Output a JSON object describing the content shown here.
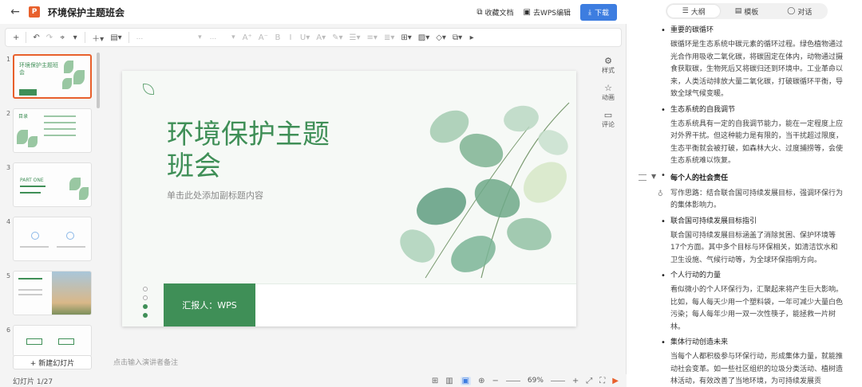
{
  "titlebar": {
    "back_icon": "back-arrow-icon",
    "app_icon_letter": "P",
    "doc_title": "环境保护主题班会",
    "collect": "收藏文档",
    "wps_edit": "去WPS编辑",
    "download": "下载"
  },
  "toolbar": {
    "font_placeholder": "...",
    "size_placeholder": "..."
  },
  "thumbnails": {
    "numbers": [
      "1",
      "2",
      "3",
      "4",
      "5",
      "6"
    ],
    "t1_title": "环境保护主题班会",
    "t2_title": "目录",
    "t3_title": "PART ONE",
    "new_slide": "+ 新建幻灯片"
  },
  "slide": {
    "title_line1": "环境保护主题",
    "title_line2": "班会",
    "subtitle": "单击此处添加副标题内容",
    "reporter": "汇报人：WPS"
  },
  "side_tools": {
    "style": "样式",
    "animation": "动画",
    "comment": "评论"
  },
  "notes_placeholder": "点击输入演讲者备注",
  "status": {
    "page": "幻灯片 1/27",
    "zoom": "69%"
  },
  "right_panel": {
    "tabs": [
      "大纲",
      "模板",
      "对话"
    ],
    "b1": "重要的碳循环",
    "p1": "碳循环是生态系统中碳元素的循环过程。绿色植物通过光合作用吸收二氧化碳，将碳固定在体内，动物通过摄食获取碳，生物死后又将碳归还到环境中。工业革命以来，人类活动排放大量二氧化碳，打破碳循环平衡，导致全球气候变暖。",
    "b2": "生态系统的自我调节",
    "p2": "生态系统具有一定的自我调节能力，能在一定程度上应对外界干扰。但这种能力是有限的，当干扰超过限度，生态平衡就会被打破，如森林大火、过度捕捞等，会使生态系统难以恢复。",
    "section": "每个人的社会责任",
    "hint": "写作思路：结合联合国可持续发展目标，强调环保行为的集体影响力。",
    "b3": "联合国可持续发展目标指引",
    "p3": "联合国可持续发展目标涵盖了消除贫困、保护环境等17个方面。其中多个目标与环保相关，如清洁饮水和卫生设施、气候行动等，为全球环保指明方向。",
    "b4": "个人行动的力量",
    "p4": "看似微小的个人环保行为，汇聚起来将产生巨大影响。比如，每人每天少用一个塑料袋，一年可减少大量白色污染；每人每年少用一双一次性筷子，能拯救一片树林。",
    "b5": "集体行动创造未来",
    "p5": "当每个人都积极参与环保行动，形成集体力量，就能推动社会变革。如一些社区组织的垃圾分类活动、植树造林活动，有效改善了当地环境，为可持续发展贡"
  },
  "colors": {
    "accent_green": "#3f8f57",
    "ppt_orange": "#e8602c",
    "download_blue": "#3d7de0"
  }
}
